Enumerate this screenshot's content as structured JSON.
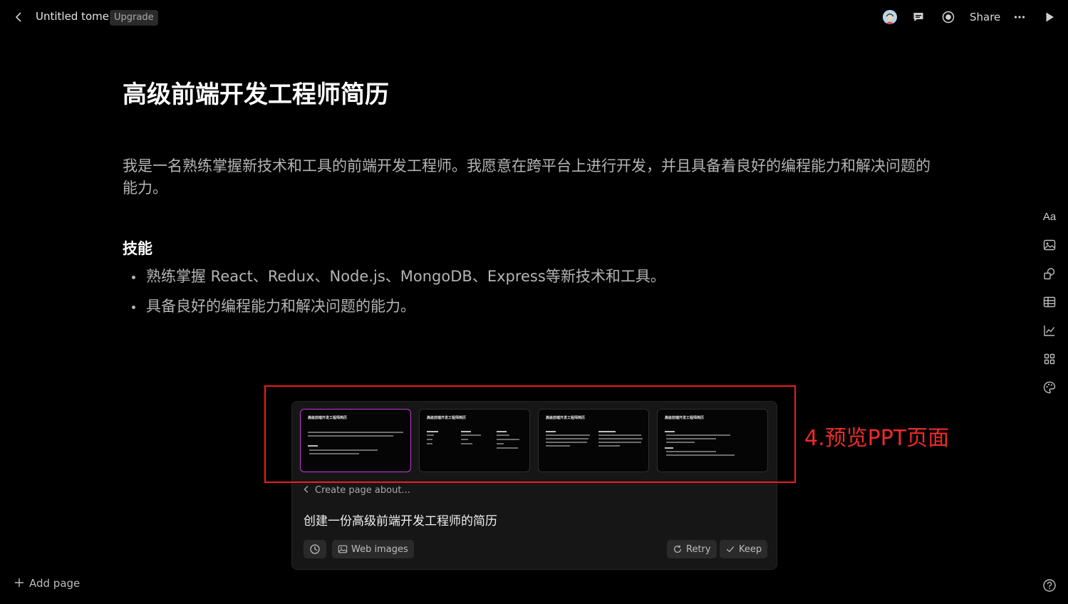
{
  "topbar": {
    "title": "Untitled tome",
    "upgrade_label": "Upgrade",
    "share_label": "Share",
    "icons": [
      "back-arrow-icon",
      "avatar",
      "comment-icon",
      "record-icon",
      "more-icon",
      "play-icon"
    ]
  },
  "document": {
    "heading": "高级前端开发工程师简历",
    "intro": "我是一名熟练掌握新技术和工具的前端开发工程师。我愿意在跨平台上进行开发，并且具备着良好的编程能力和解决问题的能力。",
    "skills_heading": "技能",
    "skills": [
      "熟练掌握 React、Redux、Node.js、MongoDB、Express等新技术和工具。",
      "具备良好的编程能力和解决问题的能力。"
    ]
  },
  "right_rail": {
    "text_tool_label": "Aa",
    "icons": [
      "text-icon",
      "image-icon",
      "shapes-icon",
      "table-icon",
      "chart-icon",
      "grid-icon",
      "palette-icon"
    ]
  },
  "generator": {
    "thumbnails": [
      {
        "title": "高级前端开发工程师简历",
        "selected": true
      },
      {
        "title": "高级前端开发工程师简历",
        "selected": false
      },
      {
        "title": "高级前端开发工程师简历",
        "selected": false
      },
      {
        "title": "高级前端开发工程师简历",
        "selected": false
      }
    ],
    "create_about_label": "Create page about...",
    "prompt": "创建一份高级前端开发工程师的简历",
    "web_images_label": "Web images",
    "retry_label": "Retry",
    "keep_label": "Keep"
  },
  "annotation": {
    "label": "4.预览PPT页面",
    "color": "#ee1d1d"
  },
  "footer": {
    "add_page_label": "Add page"
  },
  "colors": {
    "background": "#000000",
    "panel": "#161616",
    "selected_thumb_border": "#c33bd8"
  }
}
